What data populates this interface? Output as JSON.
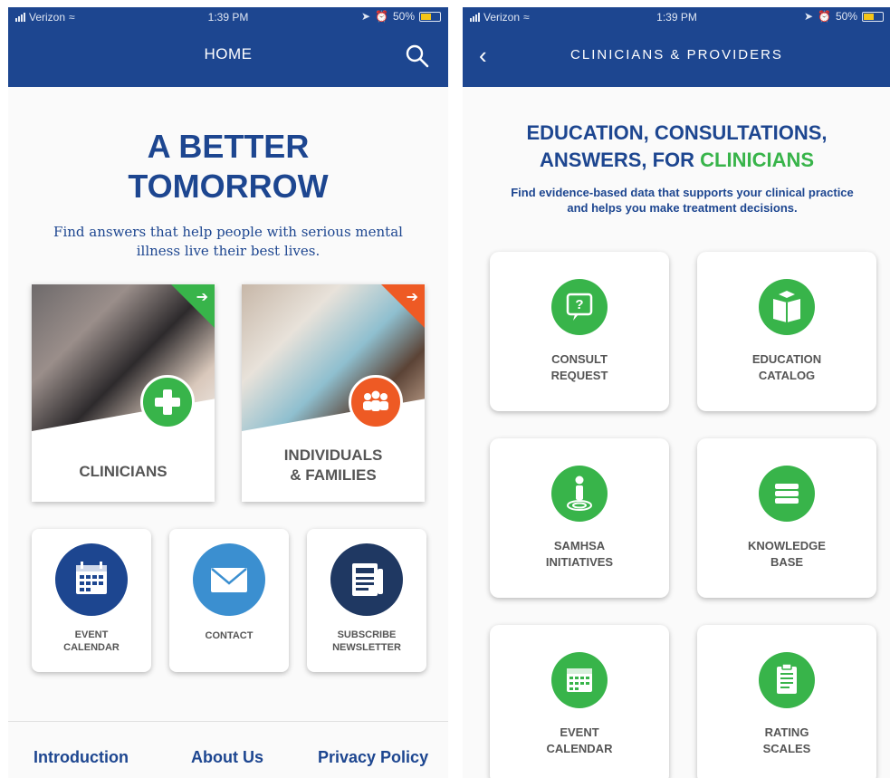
{
  "status_bar": {
    "carrier": "Verizon",
    "time": "1:39 PM",
    "battery": "50%",
    "battery_level": 0.5
  },
  "home": {
    "nav_title": "HOME",
    "hero_title_line1": "A BETTER",
    "hero_title_line2": "TOMORROW",
    "hero_subtitle": "Find answers that help people with serious mental illness live their best lives.",
    "cards": {
      "clinicians": "CLINICIANS",
      "families_line1": "INDIVIDUALS",
      "families_line2": "& FAMILIES"
    },
    "quick_links": {
      "event_line1": "EVENT",
      "event_line2": "CALENDAR",
      "contact": "CONTACT",
      "subscribe_line1": "SUBSCRIBE",
      "subscribe_line2": "NEWSLETTER"
    },
    "footer": {
      "introduction": "Introduction",
      "about": "About Us",
      "privacy": "Privacy Policy"
    }
  },
  "clinicians_page": {
    "nav_title": "CLINICIANS & PROVIDERS",
    "title_line1": "EDUCATION, CONSULTATIONS,",
    "title_line2_prefix": "ANSWERS, FOR ",
    "title_line2_accent": "CLINICIANS",
    "subtitle": "Find evidence-based data that supports your clinical practice and helps you make treatment decisions.",
    "tiles": {
      "consult_line1": "CONSULT",
      "consult_line2": "REQUEST",
      "education_line1": "EDUCATION",
      "education_line2": "CATALOG",
      "samhsa_line1": "SAMHSA",
      "samhsa_line2": "INITIATIVES",
      "knowledge_line1": "KNOWLEDGE",
      "knowledge_line2": "BASE",
      "event_line1": "EVENT",
      "event_line2": "CALENDAR",
      "rating_line1": "RATING",
      "rating_line2": "SCALES"
    }
  },
  "colors": {
    "brand_blue": "#1d4690",
    "accent_green": "#38b44a",
    "accent_orange": "#ee5a24",
    "contact_blue": "#3b8fd0"
  }
}
